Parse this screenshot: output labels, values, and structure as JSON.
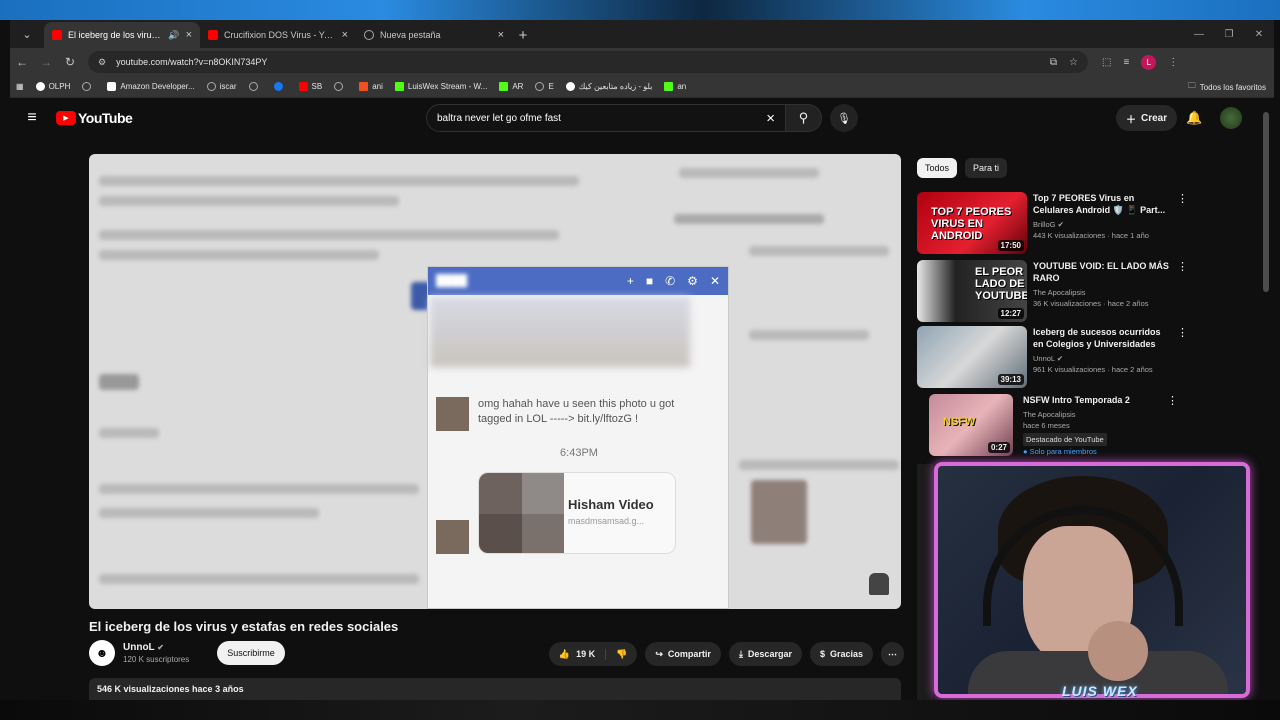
{
  "browser": {
    "tabs": [
      {
        "label": "El iceberg de los virus y estafas",
        "active": true
      },
      {
        "label": "Crucifixion DOS Virus - YouTube",
        "active": false
      },
      {
        "label": "Nueva pestaña",
        "active": false
      }
    ],
    "url": "youtube.com/watch?v=n8OKIN734PY",
    "bookmarks": [
      "OLPH",
      "Amazon Developer...",
      "iscar",
      "SB",
      "ani",
      "LuisWex Stream - W...",
      "AR",
      "E",
      "بلو - زياده متابعين كيك",
      "an"
    ],
    "all_bookmarks": "Todos los favoritos",
    "profile_initial": "L"
  },
  "youtube": {
    "logo": "YouTube",
    "search_query": "baltra never let go ofme fast",
    "create_label": "Crear"
  },
  "video": {
    "chat_text": "omg hahah have u seen this photo u got tagged in LOL -----> bit.ly/lftozG !",
    "chat_time": "6:43PM",
    "card_title": "Hisham Video",
    "card_sub": "masdmsamsad.g...",
    "title": "El iceberg de los virus y estafas en redes sociales",
    "channel": "UnnoL",
    "subscribers": "120 K suscriptores",
    "subscribe_label": "Suscribirme",
    "likes": "19 K",
    "share_label": "Compartir",
    "download_label": "Descargar",
    "thanks_label": "Gracias",
    "views_date": "546 K visualizaciones  hace 3 años"
  },
  "sidebar": {
    "chips": [
      "Todos",
      "Para ti"
    ],
    "recs": [
      {
        "title": "Top 7 PEORES Virus en Celulares Android 🛡️ 📱 Part...",
        "channel": "BrilloG",
        "meta": "443 K visualizaciones · hace 1 año",
        "duration": "17:50",
        "thumb_text": "TOP 7 PEORES VIRUS EN ANDROID",
        "color": "#d0141c"
      },
      {
        "title": "YOUTUBE VOID: EL LADO MÁS RARO",
        "channel": "The Apocalipsis",
        "meta": "36 K visualizaciones · hace 2 años",
        "duration": "12:27",
        "thumb_text": "EL PEOR LADO DE YOUTUBE",
        "color": "#3a3a3a"
      },
      {
        "title": "Iceberg de sucesos ocurridos en Colegios y Universidades",
        "channel": "UnnoL",
        "meta": "961 K visualizaciones · hace 2 años",
        "duration": "39:13",
        "thumb_text": "",
        "color": "#6a7f8f"
      },
      {
        "title": "NSFW Intro Temporada 2",
        "channel": "The Apocalipsis",
        "meta": "hace 6 meses",
        "duration": "0:27",
        "thumb_text": "NSFW",
        "color": "#9a6a7a",
        "badge": "Destacado de YouTube",
        "members": "Solo para miembros"
      }
    ]
  },
  "overlay": {
    "stream_name": "LUIS WEX"
  }
}
